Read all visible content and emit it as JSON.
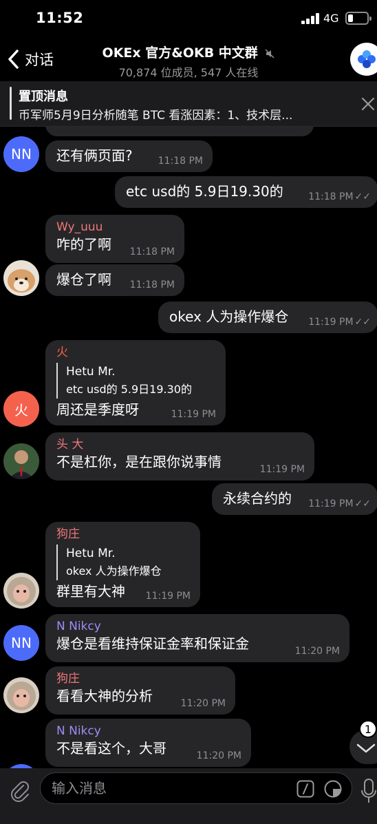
{
  "status": {
    "time": "11:52",
    "network": "4G"
  },
  "header": {
    "back_label": "对话",
    "title": "OKEx 官方&OKB 中文群",
    "subtitle": "70,874 位成员, 547 人在线"
  },
  "pinned": {
    "title": "置顶消息",
    "text": "币军师5月9日分析随笔 BTC 看涨因素：1、技术层..."
  },
  "messages": [
    {
      "text": "还有俩页面?",
      "time": "11:18 PM"
    },
    {
      "text": "etc usd的  5.9日19.30的",
      "time": "11:18 PM"
    },
    {
      "sender": "Wy_uuu",
      "text": "咋的了啊",
      "time": "11:18 PM"
    },
    {
      "text": "爆仓了啊",
      "time": "11:18 PM"
    },
    {
      "text": "okex 人为操作爆仓",
      "time": "11:19 PM"
    },
    {
      "sender": "火",
      "quote_author": "Hetu Mr.",
      "quote_text": "etc usd的  5.9日19.30的",
      "text": "周还是季度呀",
      "time": "11:19 PM"
    },
    {
      "sender": "头 大",
      "text": "不是杠你，是在跟你说事情",
      "time": "11:19 PM"
    },
    {
      "text": "永续合约的",
      "time": "11:19 PM"
    },
    {
      "sender": "狗庄",
      "quote_author": "Hetu Mr.",
      "quote_text": "okex 人为操作爆仓",
      "text": "群里有大神",
      "time": "11:19 PM"
    },
    {
      "sender": "N Nikcy",
      "text": "爆仓是看维持保证金率和保证金",
      "time": "11:20 PM"
    },
    {
      "sender": "狗庄",
      "text": "看看大神的分析",
      "time": "11:20 PM"
    },
    {
      "sender": "N Nikcy",
      "text": "不是看这个，大哥",
      "time": "11:20 PM"
    }
  ],
  "avatars": {
    "nn": "NN",
    "fire": "火"
  },
  "colors": {
    "wy_uuu": "#f0787a",
    "fire": "#f4624e",
    "toutai": "#f0787a",
    "gouzhuang": "#f0787a",
    "nikcy": "#9f8cf7",
    "nn_avatar": "#4d6bfa"
  },
  "scroll_badge": "1",
  "input": {
    "placeholder": "输入消息"
  }
}
